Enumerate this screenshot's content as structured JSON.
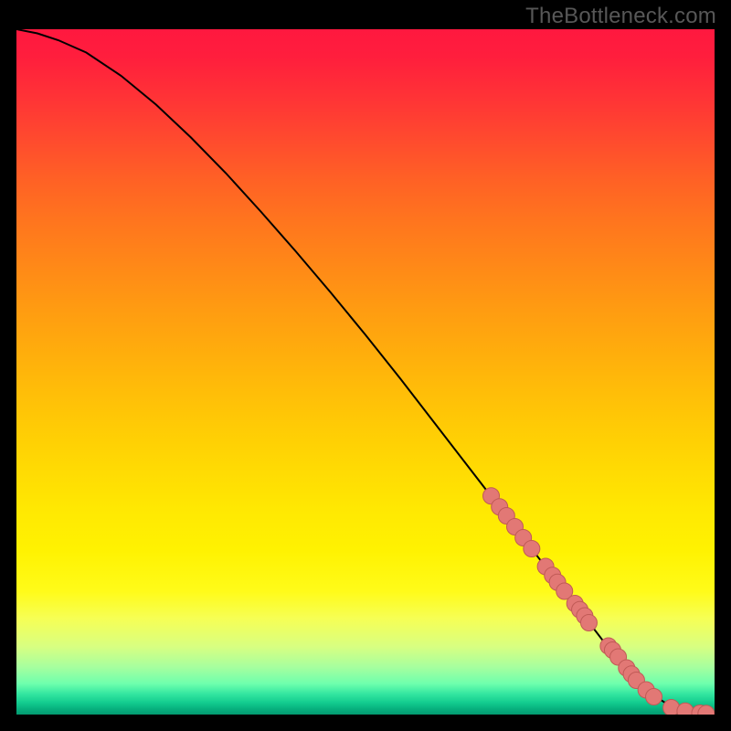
{
  "watermark": "TheBottleneck.com",
  "chart_data": {
    "type": "line",
    "title": "",
    "xlabel": "",
    "ylabel": "",
    "xlim": [
      0,
      100
    ],
    "ylim": [
      0,
      100
    ],
    "curve": {
      "x": [
        0,
        3,
        6,
        10,
        15,
        20,
        25,
        30,
        35,
        40,
        45,
        50,
        55,
        60,
        65,
        70,
        75,
        80,
        84,
        88,
        91,
        94,
        96,
        98,
        100
      ],
      "y": [
        100,
        99.4,
        98.4,
        96.6,
        93.2,
        89.0,
        84.2,
        79.0,
        73.4,
        67.6,
        61.6,
        55.4,
        49.0,
        42.4,
        35.8,
        29.2,
        22.6,
        16.1,
        10.8,
        6.0,
        3.0,
        1.0,
        0.3,
        0.1,
        0.0
      ]
    },
    "highlight_points": [
      {
        "x": 68.0,
        "y": 31.9
      },
      {
        "x": 69.2,
        "y": 30.3
      },
      {
        "x": 70.2,
        "y": 29.0
      },
      {
        "x": 71.4,
        "y": 27.4
      },
      {
        "x": 72.6,
        "y": 25.8
      },
      {
        "x": 73.8,
        "y": 24.2
      },
      {
        "x": 75.8,
        "y": 21.6
      },
      {
        "x": 76.8,
        "y": 20.3
      },
      {
        "x": 77.5,
        "y": 19.3
      },
      {
        "x": 78.5,
        "y": 18.0
      },
      {
        "x": 80.0,
        "y": 16.2
      },
      {
        "x": 80.7,
        "y": 15.3
      },
      {
        "x": 81.4,
        "y": 14.4
      },
      {
        "x": 82.0,
        "y": 13.4
      },
      {
        "x": 84.8,
        "y": 10.0
      },
      {
        "x": 85.4,
        "y": 9.4
      },
      {
        "x": 86.2,
        "y": 8.4
      },
      {
        "x": 87.4,
        "y": 6.8
      },
      {
        "x": 88.1,
        "y": 5.9
      },
      {
        "x": 88.8,
        "y": 5.0
      },
      {
        "x": 90.2,
        "y": 3.6
      },
      {
        "x": 91.3,
        "y": 2.6
      },
      {
        "x": 93.8,
        "y": 1.0
      },
      {
        "x": 95.8,
        "y": 0.5
      },
      {
        "x": 97.9,
        "y": 0.2
      },
      {
        "x": 98.8,
        "y": 0.15
      }
    ],
    "colors": {
      "curve": "#000000",
      "marker_fill": "#e27875",
      "marker_stroke": "#c05a56"
    }
  }
}
